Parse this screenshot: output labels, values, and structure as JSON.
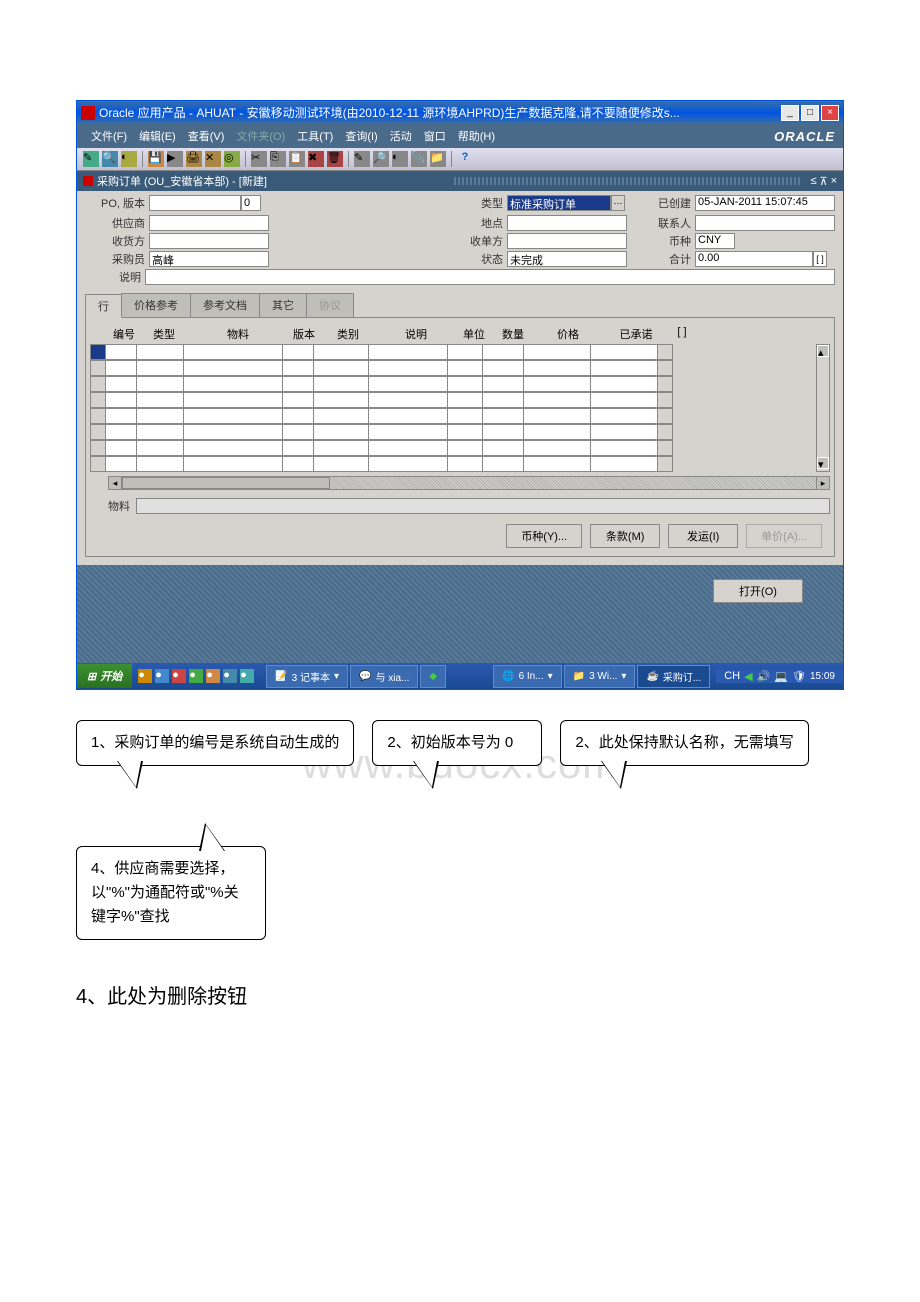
{
  "window": {
    "title": "Oracle 应用产品 - AHUAT - 安徽移动测试环境(由2010-12-11 源环境AHPRD)生产数据克隆,请不要随便修改s..."
  },
  "menubar": {
    "items": [
      "文件(F)",
      "编辑(E)",
      "查看(V)",
      "文件夹(O)",
      "工具(T)",
      "查询(I)",
      "活动",
      "窗口",
      "帮助(H)"
    ],
    "logo": "ORACLE"
  },
  "form": {
    "title": "采购订单 (OU_安徽省本部) - [新建]",
    "labels": {
      "po_ver": "PO, 版本",
      "type": "类型",
      "created": "已创建",
      "supplier": "供应商",
      "site": "地点",
      "contact": "联系人",
      "ship_to": "收货方",
      "bill_to": "收单方",
      "currency": "币种",
      "buyer": "采购员",
      "status": "状态",
      "total": "合计",
      "desc": "说明",
      "item": "物料"
    },
    "values": {
      "ver": "0",
      "type": "标准采购订单",
      "created": "05-JAN-2011 15:07:45",
      "currency": "CNY",
      "buyer": "高峰",
      "status": "未完成",
      "total": "0.00"
    },
    "tabs": [
      "行",
      "价格参考",
      "参考文档",
      "其它",
      "协议"
    ],
    "grid_headers": {
      "num": "编号",
      "type": "类型",
      "item": "物料",
      "ver": "版本",
      "cat": "类别",
      "desc": "说明",
      "uom": "单位",
      "qty": "数量",
      "price": "价格",
      "promised": "已承诺",
      "flag": "[ ]"
    },
    "buttons": {
      "currency": "币种(Y)...",
      "terms": "条款(M)",
      "shipments": "发运(I)",
      "catalog": "单价(A)...",
      "open": "打开(O)"
    }
  },
  "taskbar": {
    "start": "开始",
    "items": [
      "3 记事本",
      "与 xia...",
      "",
      "6 In...",
      "3 Wi...",
      "采购订..."
    ],
    "lang": "CH",
    "time": "15:09"
  },
  "callouts": {
    "c1": "1、采购订单的编号是系统自动生成的",
    "c2": "2、初始版本号为 0",
    "c3": "2、此处保持默认名称，无需填写",
    "c4": "4、供应商需要选择，以\"%\"为通配符或\"%关键字%\"查找"
  },
  "watermark": "www.bdocx.com",
  "body_text": "4、此处为删除按钮"
}
